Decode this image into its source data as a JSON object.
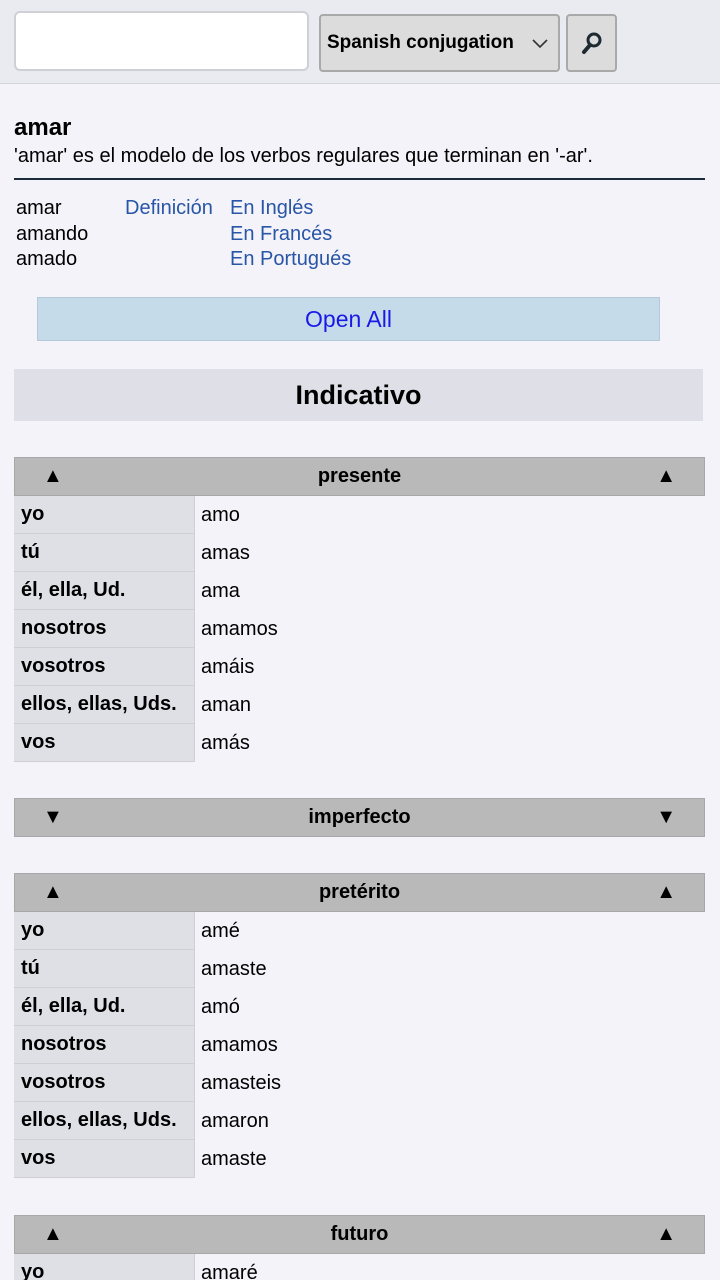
{
  "search": {
    "value": "",
    "placeholder": ""
  },
  "language_select": {
    "selected": "Spanish conjugation"
  },
  "verb": {
    "title": "amar",
    "description": "'amar' es el modelo de los verbos regulares que terminan en '-ar'."
  },
  "forms": [
    "amar",
    "amando",
    "amado"
  ],
  "links": {
    "definition": "Definición",
    "english": "En Inglés",
    "french": "En Francés",
    "portuguese": "En Portugués"
  },
  "open_all_label": "Open All",
  "mood": "Indicativo",
  "arrows": {
    "up": "▲",
    "down": "▼"
  },
  "tenses": [
    {
      "name": "presente",
      "expanded": true,
      "rows": [
        {
          "pronoun": "yo",
          "form": "amo"
        },
        {
          "pronoun": "tú",
          "form": "amas"
        },
        {
          "pronoun": "él, ella, Ud.",
          "form": "ama"
        },
        {
          "pronoun": "nosotros",
          "form": "amamos"
        },
        {
          "pronoun": "vosotros",
          "form": "amáis"
        },
        {
          "pronoun": "ellos, ellas, Uds.",
          "form": "aman"
        },
        {
          "pronoun": "vos",
          "form": "amás"
        }
      ]
    },
    {
      "name": "imperfecto",
      "expanded": false,
      "rows": []
    },
    {
      "name": "pretérito",
      "expanded": true,
      "rows": [
        {
          "pronoun": "yo",
          "form": "amé"
        },
        {
          "pronoun": "tú",
          "form": "amaste"
        },
        {
          "pronoun": "él, ella, Ud.",
          "form": "amó"
        },
        {
          "pronoun": "nosotros",
          "form": "amamos"
        },
        {
          "pronoun": "vosotros",
          "form": "amasteis"
        },
        {
          "pronoun": "ellos, ellas, Uds.",
          "form": "amaron"
        },
        {
          "pronoun": "vos",
          "form": "amaste"
        }
      ]
    },
    {
      "name": "futuro",
      "expanded": true,
      "rows": [
        {
          "pronoun": "yo",
          "form": "amaré"
        }
      ]
    }
  ],
  "icons": {
    "search": "magnifier-icon",
    "dropdown": "chevron-down-icon"
  }
}
